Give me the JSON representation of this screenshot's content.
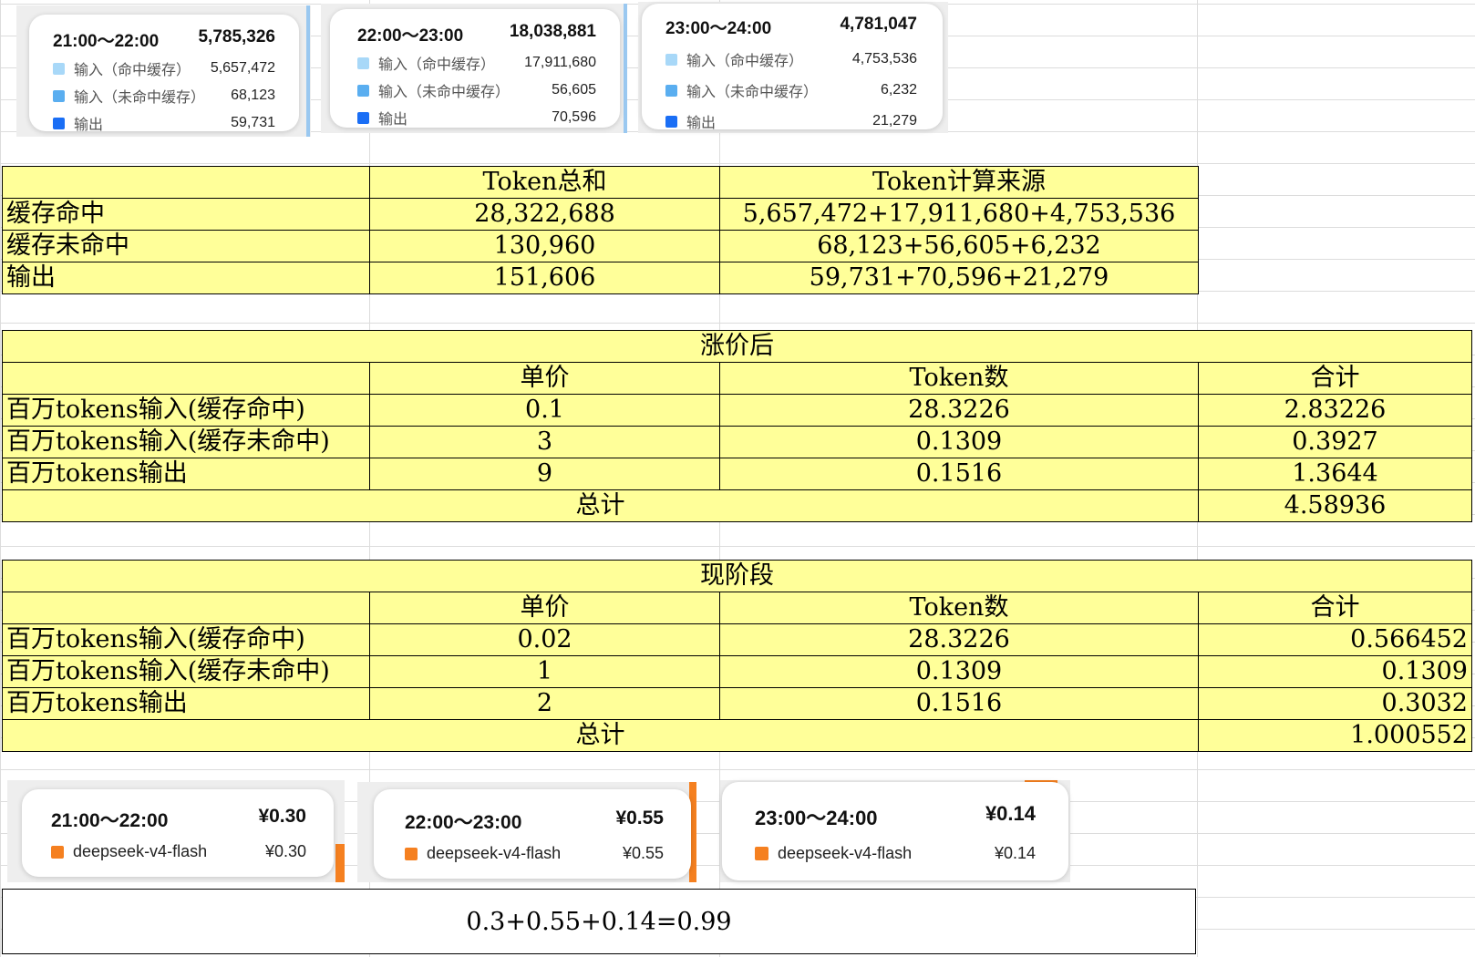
{
  "colors": {
    "cache_hit": "#a8d8f8",
    "cache_miss": "#5aaef0",
    "output": "#1a6ef5",
    "flash": "#f58020",
    "table_fill": "#ffff99"
  },
  "usage_cards": [
    {
      "time": "21:00～22:00",
      "total": "5,785,326",
      "rows": [
        {
          "label": "输入（命中缓存）",
          "value": "5,657,472"
        },
        {
          "label": "输入（未命中缓存）",
          "value": "68,123"
        },
        {
          "label": "输出",
          "value": "59,731"
        }
      ]
    },
    {
      "time": "22:00～23:00",
      "total": "18,038,881",
      "rows": [
        {
          "label": "输入（命中缓存）",
          "value": "17,911,680"
        },
        {
          "label": "输入（未命中缓存）",
          "value": "56,605"
        },
        {
          "label": "输出",
          "value": "70,596"
        }
      ]
    },
    {
      "time": "23:00～24:00",
      "total": "4,781,047",
      "rows": [
        {
          "label": "输入（命中缓存）",
          "value": "4,753,536"
        },
        {
          "label": "输入（未命中缓存）",
          "value": "6,232"
        },
        {
          "label": "输出",
          "value": "21,279"
        }
      ]
    }
  ],
  "totals_table": {
    "headers": [
      "",
      "Token总和",
      "Token计算来源"
    ],
    "rows": [
      [
        "缓存命中",
        "28,322,688",
        "5,657,472+17,911,680+4,753,536"
      ],
      [
        "缓存未命中",
        "130,960",
        "68,123+56,605+6,232"
      ],
      [
        "输出",
        "151,606",
        "59,731+70,596+21,279"
      ]
    ]
  },
  "after_table": {
    "title": "涨价后",
    "headers": [
      "",
      "单价",
      "Token数",
      "合计"
    ],
    "rows": [
      [
        "百万tokens输入(缓存命中)",
        "0.1",
        "28.3226",
        "2.83226"
      ],
      [
        "百万tokens输入(缓存未命中)",
        "3",
        "0.1309",
        "0.3927"
      ],
      [
        "百万tokens输出",
        "9",
        "0.1516",
        "1.3644"
      ]
    ],
    "total_label": "总计",
    "total_value": "4.58936"
  },
  "current_table": {
    "title": "现阶段",
    "headers": [
      "",
      "单价",
      "Token数",
      "合计"
    ],
    "rows": [
      [
        "百万tokens输入(缓存命中)",
        "0.02",
        "28.3226",
        "0.566452"
      ],
      [
        "百万tokens输入(缓存未命中)",
        "1",
        "0.1309",
        "0.1309"
      ],
      [
        "百万tokens输出",
        "2",
        "0.1516",
        "0.3032"
      ]
    ],
    "total_label": "总计",
    "total_value": "1.000552"
  },
  "cost_cards": [
    {
      "time": "21:00～22:00",
      "total": "¥0.30",
      "model": "deepseek-v4-flash",
      "value": "¥0.30"
    },
    {
      "time": "22:00～23:00",
      "total": "¥0.55",
      "model": "deepseek-v4-flash",
      "value": "¥0.55"
    },
    {
      "time": "23:00～24:00",
      "total": "¥0.14",
      "model": "deepseek-v4-flash",
      "value": "¥0.14"
    }
  ],
  "sum_formula": "0.3+0.55+0.14=0.99",
  "chart_data": {
    "type": "table",
    "token_usage": [
      {
        "period": "21:00～22:00",
        "cache_hit": 5657472,
        "cache_miss": 68123,
        "output": 59731,
        "total": 5785326
      },
      {
        "period": "22:00～23:00",
        "cache_hit": 17911680,
        "cache_miss": 56605,
        "output": 70596,
        "total": 18038881
      },
      {
        "period": "23:00～24:00",
        "cache_hit": 4753536,
        "cache_miss": 6232,
        "output": 21279,
        "total": 4781047
      }
    ],
    "cost_per_period": [
      0.3,
      0.55,
      0.14
    ]
  }
}
